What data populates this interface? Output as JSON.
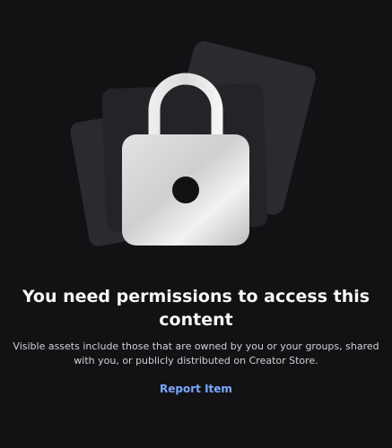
{
  "message": {
    "title_line1": "You need permissions to access this",
    "title_line2": "content",
    "description_line1": "Visible assets include those that are owned by you or your groups, shared",
    "description_line2": "with you, or publicly distributed on Creator Store."
  },
  "actions": {
    "report_label": "Report Item"
  },
  "illustration": {
    "icon": "lock-icon",
    "background": "stacked-cards"
  },
  "colors": {
    "background": "#121215",
    "title": "#f7f7f8",
    "description": "#d0d1d4",
    "link": "#7aa8ff",
    "card": "#2a2b2f"
  }
}
